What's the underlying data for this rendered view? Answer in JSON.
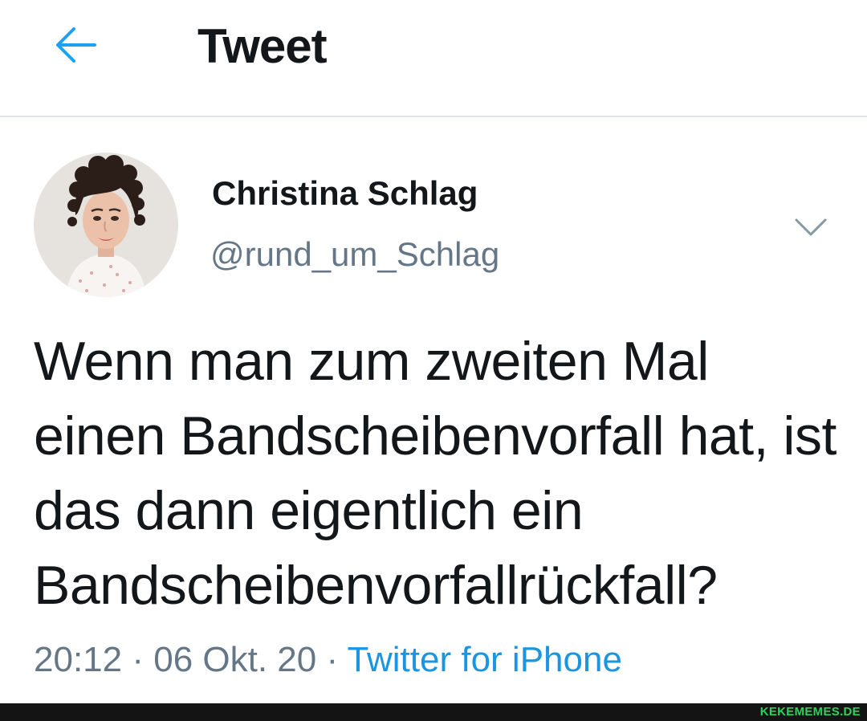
{
  "header": {
    "title": "Tweet",
    "back_icon": "arrow-left-icon",
    "accent": "#1da1f2"
  },
  "tweet": {
    "author": {
      "display_name": "Christina Schlag",
      "handle": "@rund_um_Schlag",
      "avatar_icon": "avatar-photo"
    },
    "menu_icon": "chevron-down-icon",
    "text": "Wenn man zum zweiten Mal einen Bandscheibenvorfall hat, ist das dann eigentlich ein Bandscheibenvorfallrückfall?",
    "time": "20:12",
    "date": "06 Okt. 20",
    "separator": " · ",
    "source": "Twitter for iPhone",
    "link_color": "#1b95e0",
    "meta_color": "#657786"
  },
  "footer": {
    "watermark": "KEKEMEMES.DE",
    "watermark_color": "#2ad45a"
  }
}
